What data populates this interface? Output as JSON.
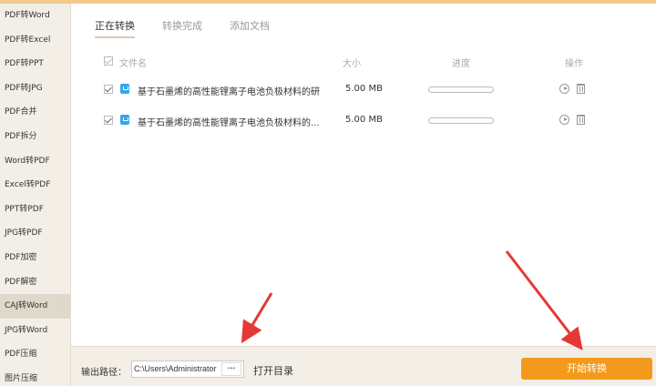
{
  "sidebar": {
    "items": [
      {
        "label": "PDF转Word"
      },
      {
        "label": "PDF转Excel"
      },
      {
        "label": "PDF转PPT"
      },
      {
        "label": "PDF转JPG"
      },
      {
        "label": "PDF合并"
      },
      {
        "label": "PDF拆分"
      },
      {
        "label": "Word转PDF"
      },
      {
        "label": "Excel转PDF"
      },
      {
        "label": "PPT转PDF"
      },
      {
        "label": "JPG转PDF"
      },
      {
        "label": "PDF加密"
      },
      {
        "label": "PDF解密"
      },
      {
        "label": "CAJ转Word"
      },
      {
        "label": "JPG转Word"
      },
      {
        "label": "PDF压缩"
      },
      {
        "label": "图片压缩"
      }
    ]
  },
  "tabs": [
    {
      "label": "正在转换"
    },
    {
      "label": "转换完成"
    },
    {
      "label": "添加文档"
    }
  ],
  "table": {
    "headers": {
      "name": "文件名",
      "size": "大小",
      "progress": "进度",
      "actions": "操作"
    },
    "rows": [
      {
        "name": "基于石墨烯的高性能锂离子电池负极材料的研",
        "size": "5.00 MB",
        "progress": 0
      },
      {
        "name": "基于石墨烯的高性能锂离子电池负极材料的...",
        "size": "5.00 MB",
        "progress": 0
      }
    ]
  },
  "bottom": {
    "output_label": "输出路径：",
    "path": "C:\\Users\\Administrator",
    "dots": "•••",
    "open_dir": "打开目录",
    "start": "开始转换"
  },
  "colors": {
    "accent": "#f39a1d",
    "sidebar_bg": "#f4efe6",
    "arrow": "#e53935"
  }
}
